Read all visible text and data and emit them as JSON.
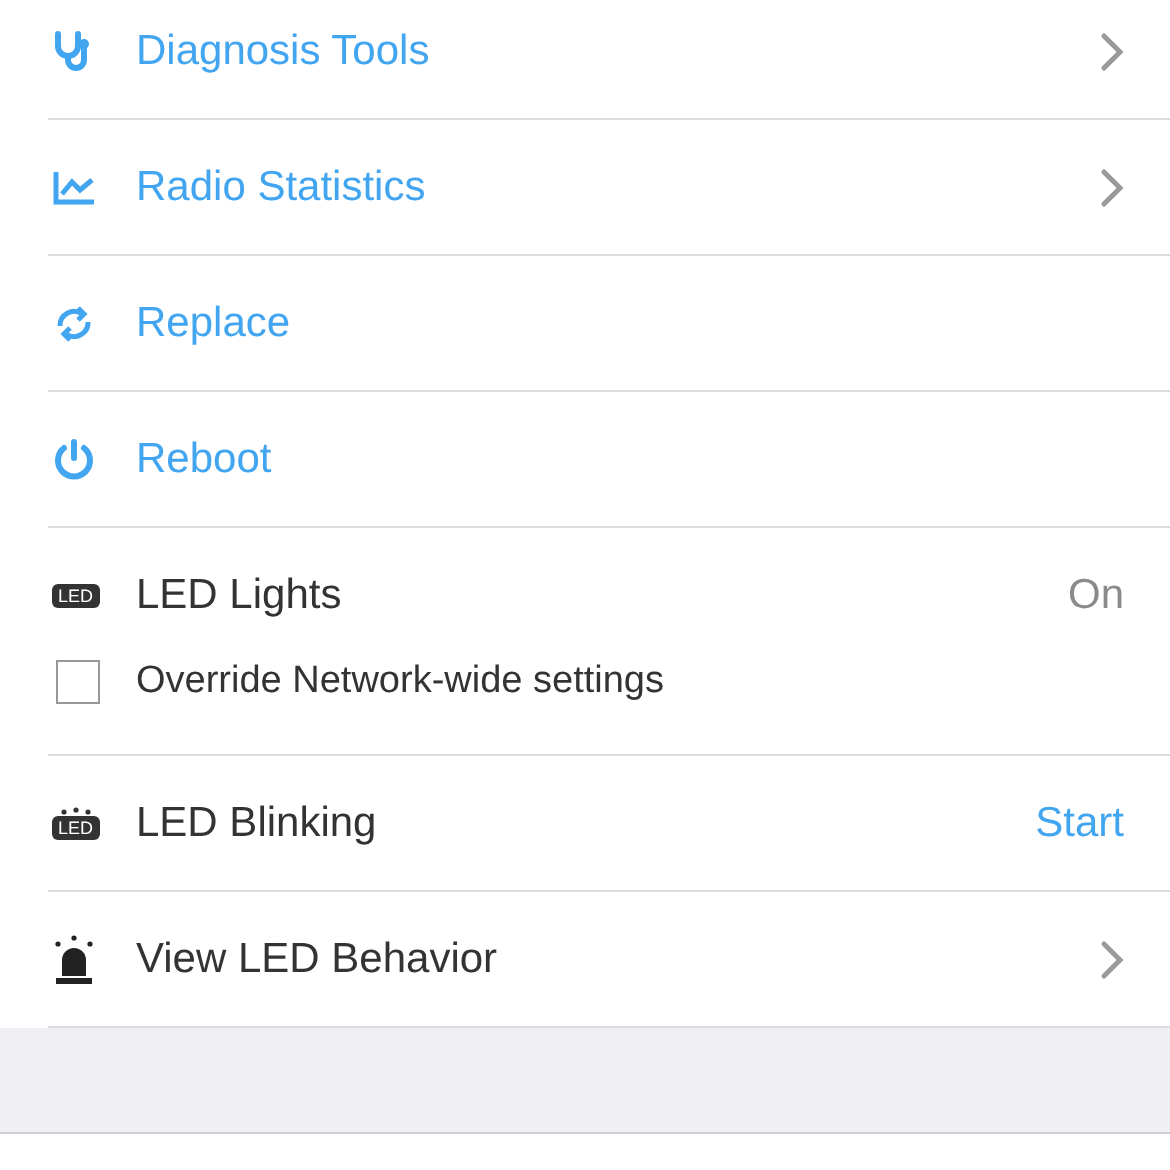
{
  "rows": [
    {
      "kind": "link",
      "label": "Diagnosis Tools",
      "chevron": true
    },
    {
      "kind": "link",
      "label": "Radio Statistics",
      "chevron": true
    },
    {
      "kind": "link",
      "label": "Replace",
      "chevron": false
    },
    {
      "kind": "link",
      "label": "Reboot",
      "chevron": false
    },
    {
      "kind": "status",
      "label": "LED Lights",
      "icon_text": "LED",
      "value": "On",
      "checkbox": {
        "label": "Override Network-wide settings",
        "checked": false
      }
    },
    {
      "kind": "action",
      "label": "LED Blinking",
      "icon_text": "LED",
      "value": "Start"
    },
    {
      "kind": "plain",
      "label": "View LED Behavior",
      "chevron": true
    }
  ]
}
